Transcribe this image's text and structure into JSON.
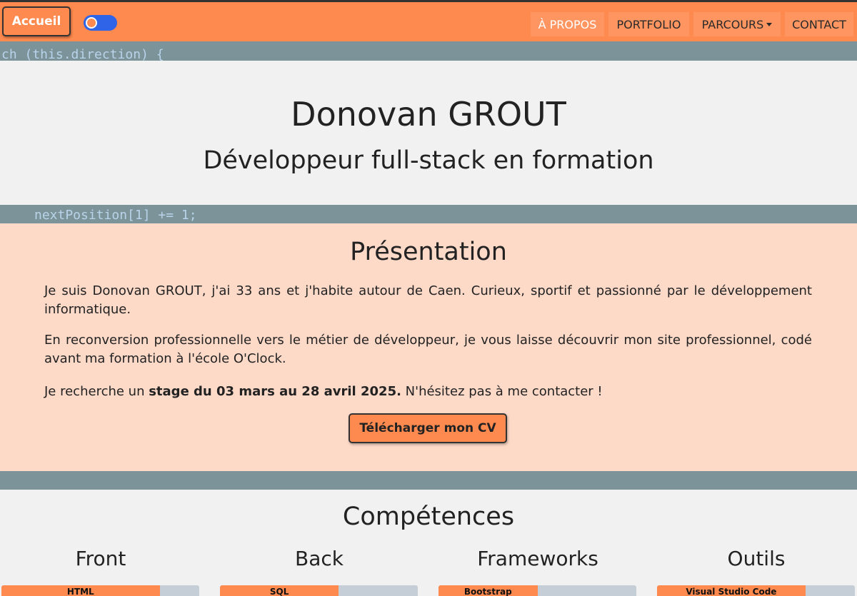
{
  "navbar": {
    "brand": "Accueil",
    "theme_toggle": "on",
    "items": [
      {
        "label": "À PROPOS",
        "active": true
      },
      {
        "label": "PORTFOLIO"
      },
      {
        "label": "PARCOURS",
        "dropdown": true
      },
      {
        "label": "CONTACT"
      }
    ]
  },
  "code_bg": {
    "line1": "ch (this.direction) {",
    "line2": "nextPosition[1] += 1;"
  },
  "hero": {
    "name": "Donovan GROUT",
    "subtitle": "Développeur full-stack en formation"
  },
  "presentation": {
    "title": "Présentation",
    "p1": "Je suis Donovan GROUT, j'ai 33 ans et j'habite autour de Caen. Curieux, sportif et passionné par le développement informatique.",
    "p2": "En reconversion professionnelle vers le métier de développeur, je vous laisse découvrir mon site professionnel, codé avant ma formation à l'école O'Clock.",
    "p3_before": "Je recherche un ",
    "p3_bold": "stage du 03 mars au 28 avril 2025.",
    "p3_after": " N'hésitez pas à me contacter !",
    "cv_button": "Télécharger mon CV"
  },
  "competences": {
    "title": "Compétences",
    "columns": [
      {
        "title": "Front",
        "first_skill": "HTML",
        "level": 0.8
      },
      {
        "title": "Back",
        "first_skill": "SQL",
        "level": 0.6
      },
      {
        "title": "Frameworks",
        "first_skill": "Bootstrap",
        "level": 0.5
      },
      {
        "title": "Outils",
        "first_skill": "Visual Studio Code",
        "level": 0.75
      }
    ]
  },
  "colors": {
    "accent": "#ff8a4f",
    "presentation_bg": "#fdd9c8",
    "code_bg": "#7b9399",
    "toggle": "#2f63e8"
  }
}
